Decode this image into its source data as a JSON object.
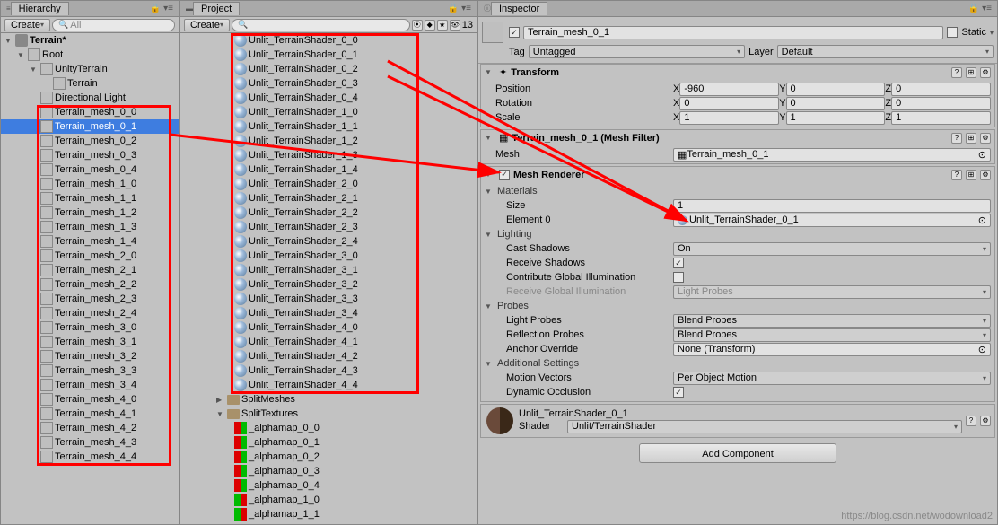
{
  "hierarchy": {
    "tab": "Hierarchy",
    "create": "Create",
    "search_placeholder": "All",
    "scene": "Terrain*",
    "root": "Root",
    "unityTerrain": "UnityTerrain",
    "terrain": "Terrain",
    "light": "Directional Light",
    "meshes": [
      "Terrain_mesh_0_0",
      "Terrain_mesh_0_1",
      "Terrain_mesh_0_2",
      "Terrain_mesh_0_3",
      "Terrain_mesh_0_4",
      "Terrain_mesh_1_0",
      "Terrain_mesh_1_1",
      "Terrain_mesh_1_2",
      "Terrain_mesh_1_3",
      "Terrain_mesh_1_4",
      "Terrain_mesh_2_0",
      "Terrain_mesh_2_1",
      "Terrain_mesh_2_2",
      "Terrain_mesh_2_3",
      "Terrain_mesh_2_4",
      "Terrain_mesh_3_0",
      "Terrain_mesh_3_1",
      "Terrain_mesh_3_2",
      "Terrain_mesh_3_3",
      "Terrain_mesh_3_4",
      "Terrain_mesh_4_0",
      "Terrain_mesh_4_1",
      "Terrain_mesh_4_2",
      "Terrain_mesh_4_3",
      "Terrain_mesh_4_4"
    ]
  },
  "project": {
    "tab": "Project",
    "create": "Create",
    "count": "13",
    "shaders": [
      "Unlit_TerrainShader_0_0",
      "Unlit_TerrainShader_0_1",
      "Unlit_TerrainShader_0_2",
      "Unlit_TerrainShader_0_3",
      "Unlit_TerrainShader_0_4",
      "Unlit_TerrainShader_1_0",
      "Unlit_TerrainShader_1_1",
      "Unlit_TerrainShader_1_2",
      "Unlit_TerrainShader_1_3",
      "Unlit_TerrainShader_1_4",
      "Unlit_TerrainShader_2_0",
      "Unlit_TerrainShader_2_1",
      "Unlit_TerrainShader_2_2",
      "Unlit_TerrainShader_2_3",
      "Unlit_TerrainShader_2_4",
      "Unlit_TerrainShader_3_0",
      "Unlit_TerrainShader_3_1",
      "Unlit_TerrainShader_3_2",
      "Unlit_TerrainShader_3_3",
      "Unlit_TerrainShader_3_4",
      "Unlit_TerrainShader_4_0",
      "Unlit_TerrainShader_4_1",
      "Unlit_TerrainShader_4_2",
      "Unlit_TerrainShader_4_3",
      "Unlit_TerrainShader_4_4"
    ],
    "folders": [
      "SplitMeshes",
      "SplitTextures"
    ],
    "textures": [
      "_alphamap_0_0",
      "_alphamap_0_1",
      "_alphamap_0_2",
      "_alphamap_0_3",
      "_alphamap_0_4",
      "_alphamap_1_0",
      "_alphamap_1_1"
    ]
  },
  "inspector": {
    "tab": "Inspector",
    "name": "Terrain_mesh_0_1",
    "static": "Static",
    "tagLabel": "Tag",
    "tagValue": "Untagged",
    "layerLabel": "Layer",
    "layerValue": "Default",
    "transform": {
      "title": "Transform",
      "position": "Position",
      "px": "-960",
      "py": "0",
      "pz": "0",
      "rotation": "Rotation",
      "rx": "0",
      "ry": "0",
      "rz": "0",
      "scale": "Scale",
      "sx": "1",
      "sy": "1",
      "sz": "1",
      "x": "X",
      "y": "Y",
      "z": "Z"
    },
    "meshfilter": {
      "title": "Terrain_mesh_0_1 (Mesh Filter)",
      "meshLabel": "Mesh",
      "meshValue": "Terrain_mesh_0_1"
    },
    "renderer": {
      "title": "Mesh Renderer",
      "materialsLabel": "Materials",
      "sizeLabel": "Size",
      "sizeValue": "1",
      "elemLabel": "Element 0",
      "elemValue": "Unlit_TerrainShader_0_1",
      "lightingLabel": "Lighting",
      "castLabel": "Cast Shadows",
      "castValue": "On",
      "receiveLabel": "Receive Shadows",
      "contribLabel": "Contribute Global Illumination",
      "receiveGILabel": "Receive Global Illumination",
      "receiveGIValue": "Light Probes",
      "probesLabel": "Probes",
      "lpLabel": "Light Probes",
      "lpValue": "Blend Probes",
      "rpLabel": "Reflection Probes",
      "rpValue": "Blend Probes",
      "aoLabel": "Anchor Override",
      "aoValue": "None (Transform)",
      "addlLabel": "Additional Settings",
      "mvLabel": "Motion Vectors",
      "mvValue": "Per Object Motion",
      "doLabel": "Dynamic Occlusion"
    },
    "material": {
      "name": "Unlit_TerrainShader_0_1",
      "shaderLabel": "Shader",
      "shaderValue": "Unlit/TerrainShader"
    },
    "addComponent": "Add Component"
  },
  "watermark": "https://blog.csdn.net/wodownload2"
}
